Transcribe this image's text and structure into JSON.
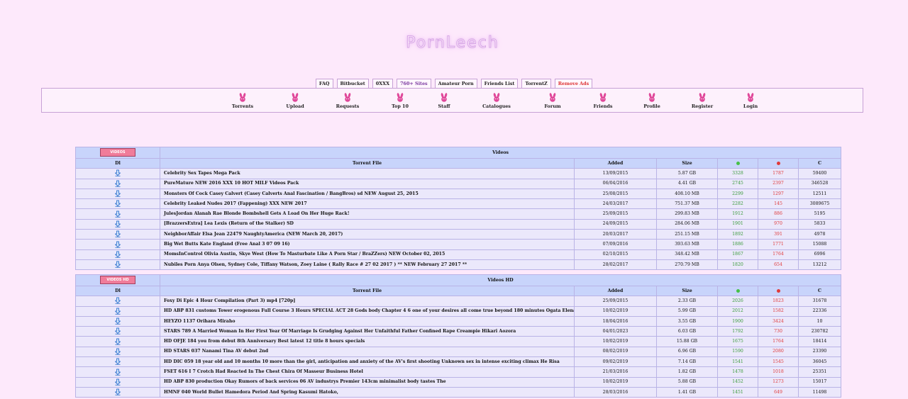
{
  "brand": {
    "logo_text": "PornLeech"
  },
  "toplinks": [
    {
      "label": "FAQ",
      "style": ""
    },
    {
      "label": "Bitbucket",
      "style": ""
    },
    {
      "label": "0XXX",
      "style": ""
    },
    {
      "label": "760+ Sites",
      "style": "purple"
    },
    {
      "label": "Amateur Porn",
      "style": ""
    },
    {
      "label": "Friends List",
      "style": ""
    },
    {
      "label": "TorrentZ",
      "style": ""
    },
    {
      "label": "Remove Ads",
      "style": "red"
    }
  ],
  "nav": [
    {
      "label": "Torrents",
      "icon": "bunny-icon"
    },
    {
      "label": "Upload",
      "icon": "bunny-icon"
    },
    {
      "label": "Requests",
      "icon": "bunny-icon"
    },
    {
      "label": "Top 10",
      "icon": "bunny-icon"
    },
    {
      "label": "Staff",
      "icon": "bunny-icon"
    },
    {
      "label": "Catalogues",
      "icon": "bunny-icon"
    },
    {
      "label": "Forum",
      "icon": "bunny-icon"
    },
    {
      "label": "Friends",
      "icon": "bunny-icon"
    },
    {
      "label": "Profile",
      "icon": "bunny-icon"
    },
    {
      "label": "Register",
      "icon": "bunny-icon"
    },
    {
      "label": "Login",
      "icon": "bunny-icon"
    }
  ],
  "colors": {
    "seed_dot": "#46c046",
    "leech_dot": "#e03a3a",
    "bunny": "#e0489a",
    "download": "#3a7ad0"
  },
  "columns": {
    "dl": "Dl",
    "file": "Torrent File",
    "added": "Added",
    "size": "Size",
    "completed": "C"
  },
  "sections": [
    {
      "title": "Videos",
      "badge": "VIDEOS",
      "rows": [
        {
          "name": "Celebrity Sex Tapes Mega Pack",
          "added": "13/09/2015",
          "size": "5.87 GB",
          "seeders": "3328",
          "leechers": "1787",
          "completed": "59400"
        },
        {
          "name": "PureMature NEW 2016 XXX 10 HOT MILF Videos Pack",
          "added": "06/04/2016",
          "size": "4.41 GB",
          "seeders": "2745",
          "leechers": "2397",
          "completed": "346528"
        },
        {
          "name": "Monsters Of Cock Casey Calvert (Casey Calverts Anal Fascination / BangBros) sd NEW August 25, 2015",
          "added": "25/08/2015",
          "size": "408.10 MB",
          "seeders": "2299",
          "leechers": "1297",
          "completed": "12511"
        },
        {
          "name": "Celebrity Leaked Nudes 2017 (Fappening) XXX NEW 2017",
          "added": "24/03/2017",
          "size": "751.37 MB",
          "seeders": "2282",
          "leechers": "145",
          "completed": "3089675"
        },
        {
          "name": "JulesJordan Alanah Rae Blonde Bombshell Gets A Load On Her Huge Rack!",
          "added": "25/09/2015",
          "size": "299.83 MB",
          "seeders": "1912",
          "leechers": "886",
          "completed": "5195"
        },
        {
          "name": "[BrazzersExtra] Lea Lexis (Return of the Stalker) SD",
          "added": "24/09/2015",
          "size": "284.06 MB",
          "seeders": "1901",
          "leechers": "970",
          "completed": "5833"
        },
        {
          "name": "NeighborAffair Elsa Jean 22479 NaughtyAmerica (NEW March 20, 2017)",
          "added": "20/03/2017",
          "size": "251.15 MB",
          "seeders": "1892",
          "leechers": "391",
          "completed": "4978"
        },
        {
          "name": "Big Wet Butts Kate England (Free Anal 3 07 09 16)",
          "added": "07/09/2016",
          "size": "393.63 MB",
          "seeders": "1886",
          "leechers": "1771",
          "completed": "15088"
        },
        {
          "name": "MomsInControl Olivia Austin, Skye West (How To Masturbate Like A Porn Star / BraZZers) NEW October 02, 2015",
          "added": "02/10/2015",
          "size": "348.42 MB",
          "seeders": "1867",
          "leechers": "1764",
          "completed": "6996"
        },
        {
          "name": "Nubiles Porn Anya Olsen, Sydney Cole, Tiffany Watson, Zoey Laine ( Rally Race # 27 02 2017 ) ** NEW February 27 2017 **",
          "added": "28/02/2017",
          "size": "270.79 MB",
          "seeders": "1820",
          "leechers": "654",
          "completed": "13212"
        }
      ]
    },
    {
      "title": "Videos HD",
      "badge": "VIDEOS HD",
      "rows": [
        {
          "name": "Foxy Di Epic 4 Hour Compilation (Part 3) mp4 [720p]",
          "added": "25/09/2015",
          "size": "2.33 GB",
          "seeders": "2026",
          "leechers": "1823",
          "completed": "31678"
        },
        {
          "name": "HD ABP 831 customs Tower erogenous Full Course 3 Hours SPECIAL ACT 28 Gods body Chapter 4 6 one of your desires all come true beyond 180 minutes Ogata Elena",
          "added": "10/02/2019",
          "size": "5.99 GB",
          "seeders": "2012",
          "leechers": "1582",
          "completed": "22336"
        },
        {
          "name": "HEYZO 1137 Orihara Miraho",
          "added": "18/04/2016",
          "size": "3.55 GB",
          "seeders": "1900",
          "leechers": "3424",
          "completed": "10"
        },
        {
          "name": "STARS 789 A Married Woman In Her First Year Of Marriage Is Grudging Against Her Unfaithful Father Confined Rape Creampie Hikari Aozora",
          "added": "04/01/2023",
          "size": "6.03 GB",
          "seeders": "1792",
          "leechers": "730",
          "completed": "230782"
        },
        {
          "name": "HD OFJE 184 you from debut 8th Anniversary Best latest 12 title 8 hours specials",
          "added": "10/02/2019",
          "size": "15.88 GB",
          "seeders": "1675",
          "leechers": "1764",
          "completed": "18414"
        },
        {
          "name": "HD STARS 037 Nanami Tina AV debut 2nd",
          "added": "08/02/2019",
          "size": "6.96 GB",
          "seeders": "1590",
          "leechers": "2080",
          "completed": "23390"
        },
        {
          "name": "HD DIC 059 18 year old and 10 months 10 more than the girl, anticipation and anxiety of the AV's first shooting Unknown sex in intense exciting climax He Risa",
          "added": "09/02/2019",
          "size": "7.14 GB",
          "seeders": "1541",
          "leechers": "1545",
          "completed": "36045"
        },
        {
          "name": "FSET 616 I 7 Crotch Had Reacted In The Chest Chira Of Masseur Business Hotel",
          "added": "21/03/2016",
          "size": "1.82 GB",
          "seeders": "1478",
          "leechers": "1018",
          "completed": "25351"
        },
        {
          "name": "HD ABP 830 production Okay Rumors of back services 06 AV industrys Premier 143cm minimalist body tastes The",
          "added": "10/02/2019",
          "size": "5.88 GB",
          "seeders": "1452",
          "leechers": "1273",
          "completed": "15017"
        },
        {
          "name": "HMNF 040 World Bullet Hamedora Period And Spring Kasumi Hatoko,",
          "added": "28/03/2016",
          "size": "1.41 GB",
          "seeders": "1451",
          "leechers": "649",
          "completed": "11498"
        }
      ]
    }
  ]
}
